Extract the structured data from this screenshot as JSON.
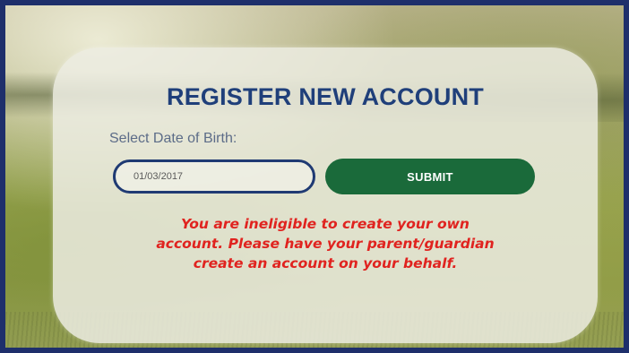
{
  "register": {
    "title": "REGISTER NEW ACCOUNT",
    "dob_label": "Select Date of Birth:",
    "dob_value": "01/03/2017",
    "submit_label": "SUBMIT",
    "error_lines": [
      "You are ineligible to create your own",
      "account. Please have your parent/guardian",
      "create an account on your behalf."
    ]
  },
  "colors": {
    "title": "#1f3f7a",
    "submit_bg": "#1a6a3a",
    "error": "#e0231f",
    "frame_border": "#1e2f6b"
  },
  "icons": []
}
